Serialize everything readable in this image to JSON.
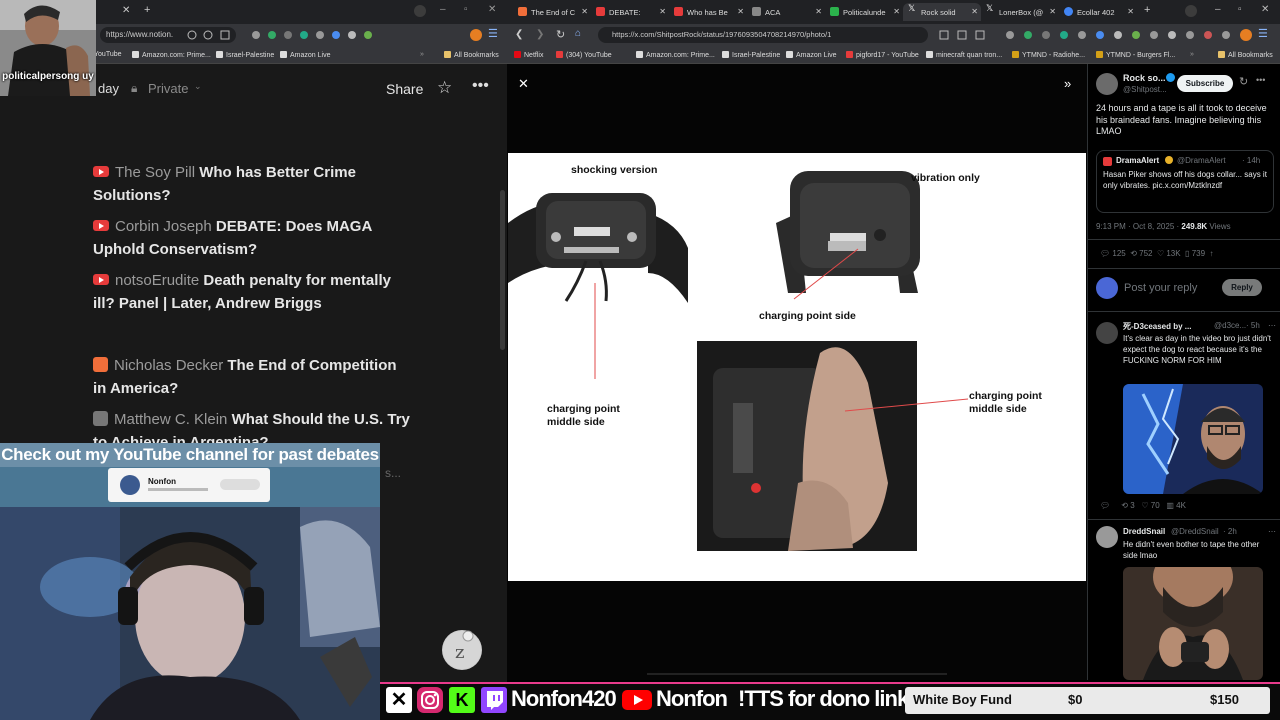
{
  "left_browser": {
    "url": "https://www.notion.",
    "bookmarks": [
      "YouTube",
      "Amazon.com: Prime...",
      "Israel-Palestine",
      "Amazon Live",
      "All Bookmarks"
    ],
    "notion_header": {
      "page_partial": "day",
      "privacy": "Private",
      "share_label": "Share"
    },
    "feed": [
      {
        "source_icon": "youtube",
        "author": "The Soy Pill",
        "title": "Who has Better Crime Solutions?"
      },
      {
        "source_icon": "youtube",
        "author": "Corbin Joseph",
        "title": "DEBATE: Does MAGA Uphold Conservatism?"
      },
      {
        "source_icon": "youtube",
        "author": "notsoErudite",
        "title": "Death penalty for mentally ill? Panel | Later, Andrew Briggs"
      },
      {
        "source_icon": "substack",
        "author": "Nicholas Decker",
        "title": "The End of Competition in America?"
      },
      {
        "source_icon": "macro",
        "author": "Matthew C. Klein",
        "title": "What Should the U.S. Try to Achieve in Argentina?"
      }
    ]
  },
  "overlays": {
    "webcam_label": "politicalpersong uy",
    "promo_text": "Check out my YouTube channel for past debates",
    "yt_card_name": "Nonfon"
  },
  "right_browser": {
    "tabs": [
      {
        "label": "The End of C",
        "color": "#f16e3a"
      },
      {
        "label": "DEBATE:",
        "color": "#e63b3b"
      },
      {
        "label": "Who has Be",
        "color": "#e63b3b"
      },
      {
        "label": "ACA",
        "color": "#888888"
      },
      {
        "label": "Politicalunde",
        "color": "#2bb24c"
      },
      {
        "label": "Rock solid",
        "color": "#ffffff"
      },
      {
        "label": "LonerBox (@",
        "color": "#ffffff"
      },
      {
        "label": "Ecollar 402",
        "color": "#4285f4"
      }
    ],
    "url": "https://x.com/ShitpostRock/status/1976093504708214970/photo/1",
    "bookmarks": [
      "Netflix",
      "(304) YouTube",
      "Amazon.com: Prime...",
      "Israel-Palestine",
      "Amazon Live",
      "pigford17 - YouTube",
      "minecraft quan tron...",
      "YTMND - Radiohe...",
      "YTMND - Burgers Fl...",
      "All Bookmarks"
    ],
    "photo_labels": {
      "shocking": "shocking version",
      "vibration": "vibration only",
      "charging_side": "charging point side",
      "charging_middle_left": "charging point\nmiddle side",
      "charging_middle_right": "charging point\nmiddle side"
    },
    "sidebar": {
      "author_name": "Rock so...",
      "author_handle": "@Shitpost...",
      "subscribe_label": "Subscribe",
      "tweet_text": "24 hours and a tape is all it took to deceive his braindead fans. Imagine believing this LMAO",
      "quote": {
        "name": "DramaAlert",
        "handle": "@DramaAlert",
        "time": "· 14h",
        "text": "Hasan Piker shows off his dogs collar... says it only vibrates. pic.x.com/Mztklnzdf"
      },
      "meta": "9:13 PM · Oct 8, 2025 · ",
      "views": "249.8K",
      "views_label": "Views",
      "stats": {
        "replies": "125",
        "reposts": "752",
        "likes": "13K",
        "bookmarks": "739"
      },
      "reply_placeholder": "Post your reply",
      "reply_button": "Reply",
      "replies": [
        {
          "name": "死-D3ceased by ...",
          "handle": "@d3ce...",
          "time": "· 5h",
          "text": "It's clear as day in the video bro just didn't expect the dog to react because it's the FUCKING NORM FOR HIM",
          "stats": {
            "reposts": "3",
            "likes": "70",
            "views": "4K"
          }
        },
        {
          "name": "DreddSnail",
          "handle": "@DreddSnail",
          "time": "· 2h",
          "text": "He didn't even bother to tape the other side lmao"
        }
      ]
    }
  },
  "bottom_bar": {
    "handle": "Nonfon420",
    "youtube_name": "Nonfon",
    "tts": "!TTS for dono link",
    "fund_label": "White Boy Fund",
    "fund_current": "$0",
    "fund_goal": "$150",
    "fund_progress": 0,
    "accent": "#e83a8c"
  }
}
